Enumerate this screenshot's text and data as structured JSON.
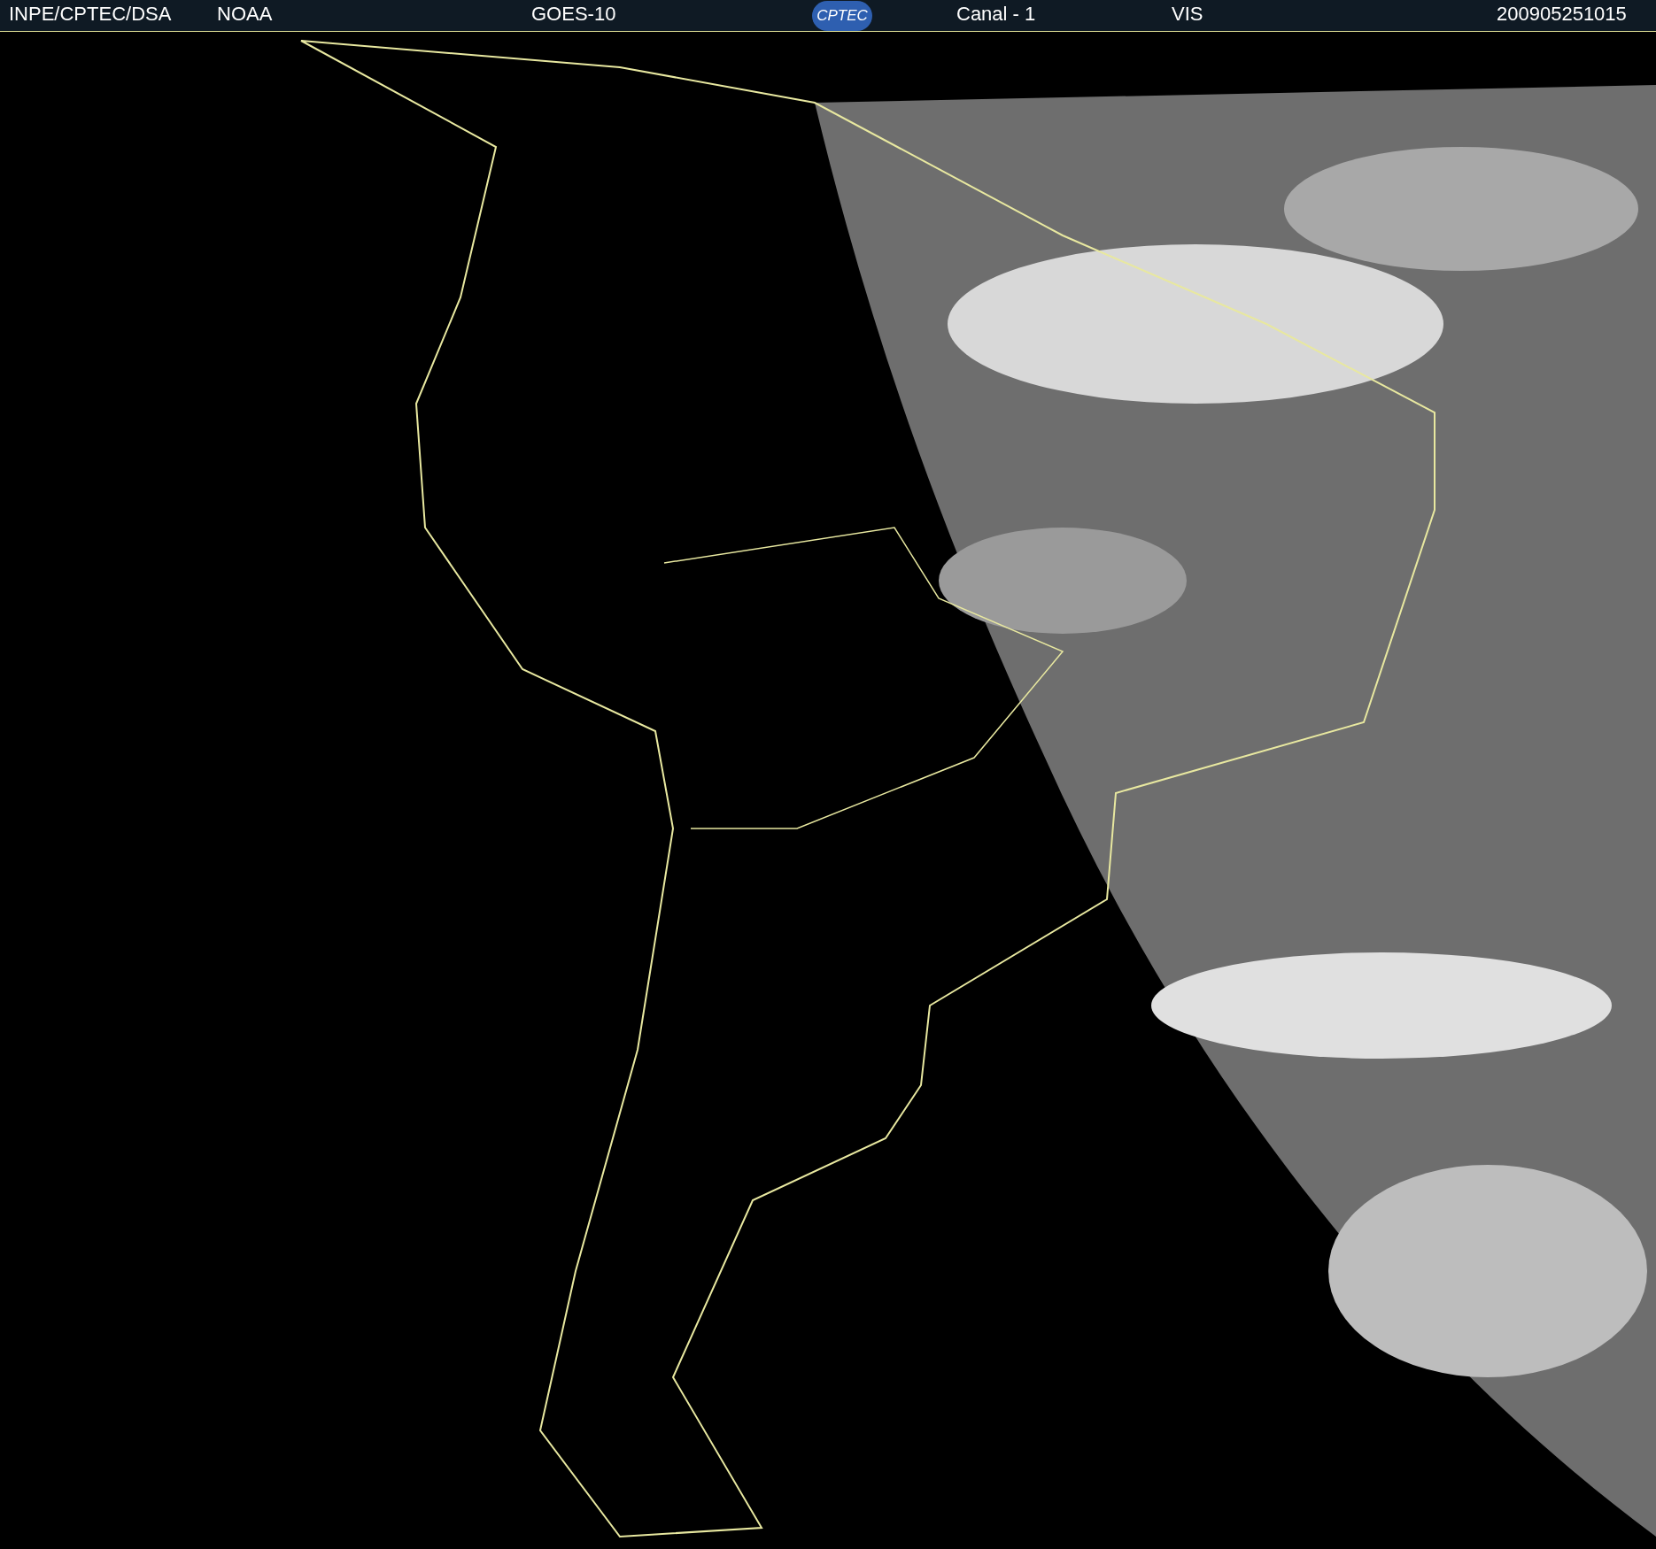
{
  "header": {
    "source": "INPE/CPTEC/DSA",
    "agency": "NOAA",
    "satellite": "GOES-10",
    "logo": "CPTEC",
    "channel": "Canal - 1",
    "band": "VIS",
    "timestamp": "200905251015"
  }
}
